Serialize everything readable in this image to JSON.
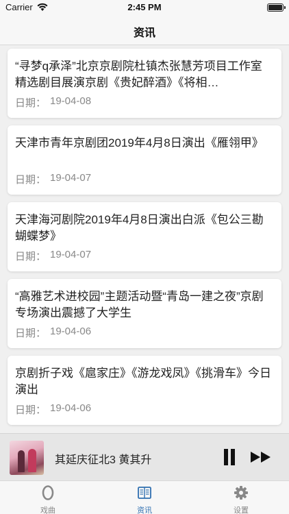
{
  "status_bar": {
    "carrier": "Carrier",
    "time": "2:45 PM"
  },
  "nav": {
    "title": "资讯"
  },
  "date_label": "日期：",
  "news": [
    {
      "title": "“寻梦q承泽”北京京剧院杜镇杰张慧芳项目工作室精选剧目展演京剧《贵妃醉酒》《将相…",
      "date": "19-04-08"
    },
    {
      "title": "天津市青年京剧团2019年4月8日演出《雁翎甲》",
      "date": "19-04-07"
    },
    {
      "title": "天津海河剧院2019年4月8日演出白派《包公三勘蝴蝶梦》",
      "date": "19-04-07"
    },
    {
      "title": "“高雅艺术进校园”主题活动暨“青岛一建之夜”京剧专场演出震撼了大学生",
      "date": "19-04-06"
    },
    {
      "title": "京剧折子戏《扈家庄》《游龙戏凤》《挑滑车》今日演出",
      "date": "19-04-06"
    }
  ],
  "player": {
    "song": "其延庆征北3 黄其升"
  },
  "tabs": [
    {
      "label": "戏曲",
      "icon": "opera-icon"
    },
    {
      "label": "资讯",
      "icon": "news-icon",
      "active": true
    },
    {
      "label": "设置",
      "icon": "gear-icon"
    }
  ],
  "colors": {
    "accent": "#2f6fb0",
    "inactive": "#888888"
  }
}
